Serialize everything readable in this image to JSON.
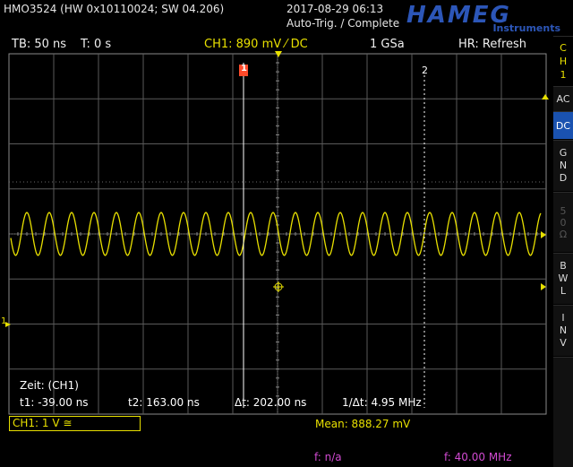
{
  "header": {
    "device": "HMO3524 (HW 0x10110024; SW 04.206)",
    "datetime": "2017-08-29 06:13",
    "trigger_status": "Auto-Trig. / Complete",
    "brand": "HAMEG",
    "brand_sub": "Instruments"
  },
  "status_bar": {
    "timebase": "TB: 50 ns",
    "trigger_time": "T: 0 s",
    "channel": "CH1: 890 mV ⁄ DC",
    "sample_rate": "1 GSa",
    "horizontal_mode": "HR: Refresh"
  },
  "side_menu": {
    "channel_tab": [
      "C",
      "H",
      "1"
    ],
    "items": [
      {
        "id": "ac",
        "label": "AC",
        "active": false
      },
      {
        "id": "dc",
        "label": "DC",
        "active": true
      },
      {
        "id": "gnd",
        "label": "GND",
        "active": false
      },
      {
        "id": "50ohm",
        "label": "50Ω",
        "active": false
      },
      {
        "id": "bwl",
        "label": "BWL",
        "active": false
      },
      {
        "id": "inv",
        "label": "INV",
        "active": false
      }
    ]
  },
  "markers": {
    "cursor1": "1",
    "cursor2": "2",
    "channel": "1"
  },
  "cursor_measure": {
    "title": "Zeit: (CH1)",
    "t1": "t1: -39.00 ns",
    "t2": "t2: 163.00 ns",
    "dt": "Δt: 202.00 ns",
    "inv_dt": "1/Δt: 4.95 MHz"
  },
  "bottom": {
    "channel_setting": "CH1: 1 V ≅",
    "mean": "Mean: 888.27 mV",
    "f_label": "f: n/a",
    "f_value": "f: 40.00 MHz"
  },
  "colors": {
    "trace": "#e8e000",
    "grid": "#5a5a5a",
    "accent": "#1a52b0",
    "cursor_marker": "#ff4a2a",
    "freq_text": "#d04ad0"
  },
  "waveform": {
    "frequency_mhz": 40,
    "timebase_ns_per_div": 50,
    "peak_to_peak_div": 1.0
  }
}
